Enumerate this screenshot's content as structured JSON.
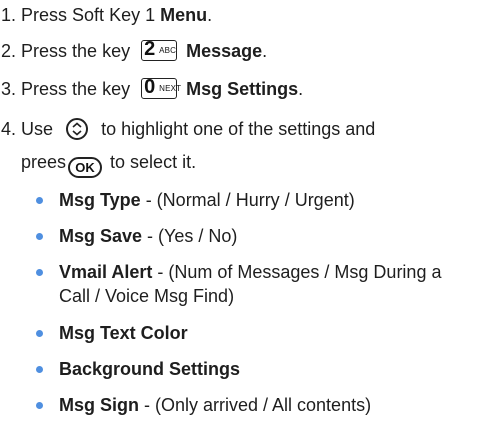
{
  "steps": [
    {
      "num": "1.",
      "text": "Press Soft Key 1",
      "bold": "Menu",
      "end": "."
    },
    {
      "num": "2.",
      "text": "Press the key",
      "key_main": "2",
      "key_sub": "ABC",
      "bold": "Message",
      "end": "."
    },
    {
      "num": "3.",
      "text": "Press the key",
      "key_main": "0",
      "key_sub": "NEXT",
      "bold": "Msg Settings",
      "end": "."
    },
    {
      "num": "4.",
      "text_a": "Use",
      "text_b": "to highlight one of the settings and",
      "text_c": "prees",
      "ok": "OK",
      "text_d": "to select it."
    }
  ],
  "settings": [
    {
      "name": "Msg Type",
      "desc": " - (Normal / Hurry / Urgent)"
    },
    {
      "name": "Msg Save",
      "desc": " - (Yes / No)"
    },
    {
      "name": "Vmail Alert",
      "desc": " - (Num of Messages / Msg During a",
      "desc2": "Call / Voice Msg Find)"
    },
    {
      "name": "Msg Text Color",
      "desc": ""
    },
    {
      "name": "Background Settings",
      "desc": ""
    },
    {
      "name": "Msg Sign",
      "desc": " - (Only arrived / All contents)"
    }
  ],
  "colors": {
    "bullet": "#4f8fe0",
    "text": "#1e1e1e"
  }
}
